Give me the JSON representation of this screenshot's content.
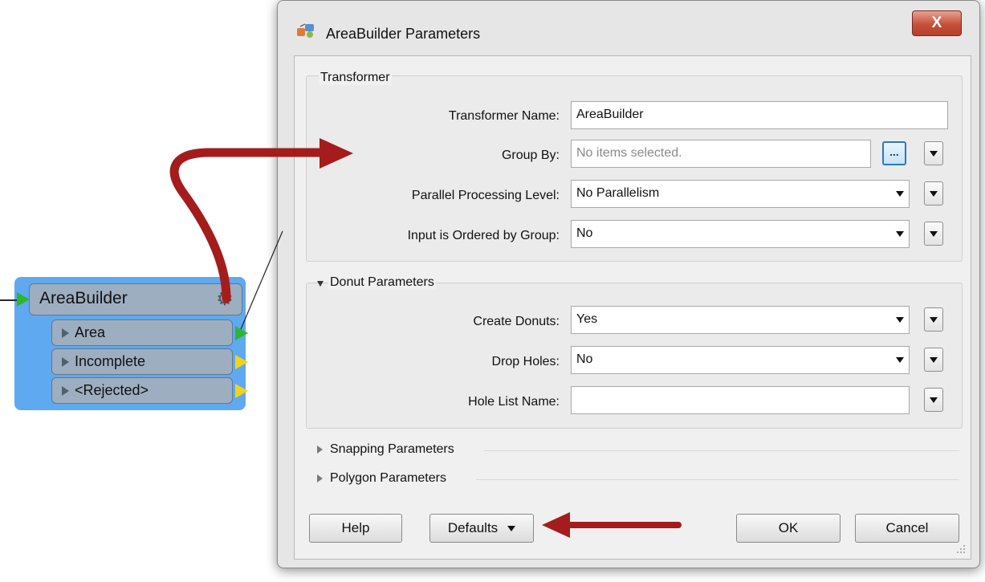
{
  "workspace": {
    "transformer": {
      "title": "AreaBuilder",
      "ports": [
        {
          "label": "Area",
          "arrow": "green"
        },
        {
          "label": "Incomplete",
          "arrow": "yellow"
        },
        {
          "label": "<Rejected>",
          "arrow": "yellow"
        }
      ]
    }
  },
  "dialog": {
    "title": "AreaBuilder Parameters",
    "close_label": "X",
    "transformer_group": {
      "title": "Transformer",
      "fields": {
        "transformer_name": {
          "label": "Transformer Name:",
          "value": "AreaBuilder"
        },
        "group_by": {
          "label": "Group By:",
          "placeholder": "No items selected.",
          "ellipsis": "..."
        },
        "parallel": {
          "label": "Parallel Processing Level:",
          "value": "No Parallelism"
        },
        "ordered": {
          "label": "Input is Ordered by Group:",
          "value": "No"
        }
      }
    },
    "donut_group": {
      "title": "Donut Parameters",
      "fields": {
        "create_donuts": {
          "label": "Create Donuts:",
          "value": "Yes"
        },
        "drop_holes": {
          "label": "Drop Holes:",
          "value": "No"
        },
        "hole_list_name": {
          "label": "Hole List Name:",
          "value": ""
        }
      }
    },
    "collapsed_sections": [
      "Snapping Parameters",
      "Polygon Parameters"
    ],
    "buttons": {
      "help": "Help",
      "defaults": "Defaults",
      "ok": "OK",
      "cancel": "Cancel"
    }
  },
  "colors": {
    "workspace_selection": "#5fa9f0",
    "transformer_fill": "#9daec1",
    "port_green": "#2fb62f",
    "port_yellow": "#f2d31a",
    "annotation_arrow": "#a51c1c",
    "close_button": "#c64f3a"
  }
}
